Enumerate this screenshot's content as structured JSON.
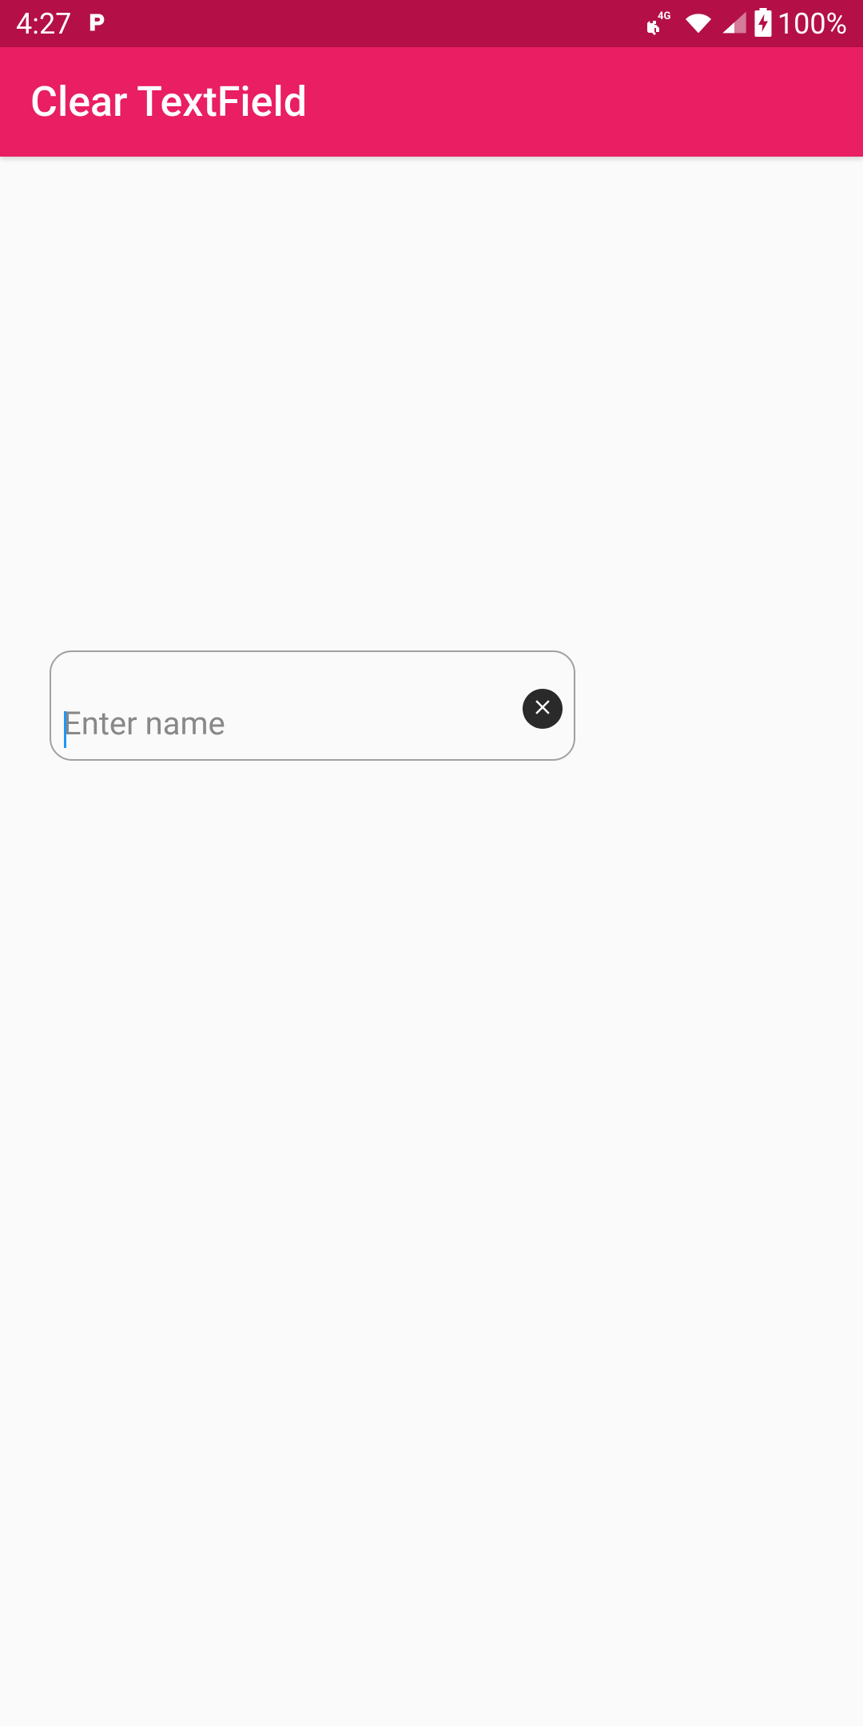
{
  "status_bar": {
    "time": "4:27",
    "network_type": "4G",
    "battery_percent": "100%"
  },
  "app_bar": {
    "title": "Clear TextField"
  },
  "textfield": {
    "placeholder": "Enter name",
    "value": ""
  }
}
